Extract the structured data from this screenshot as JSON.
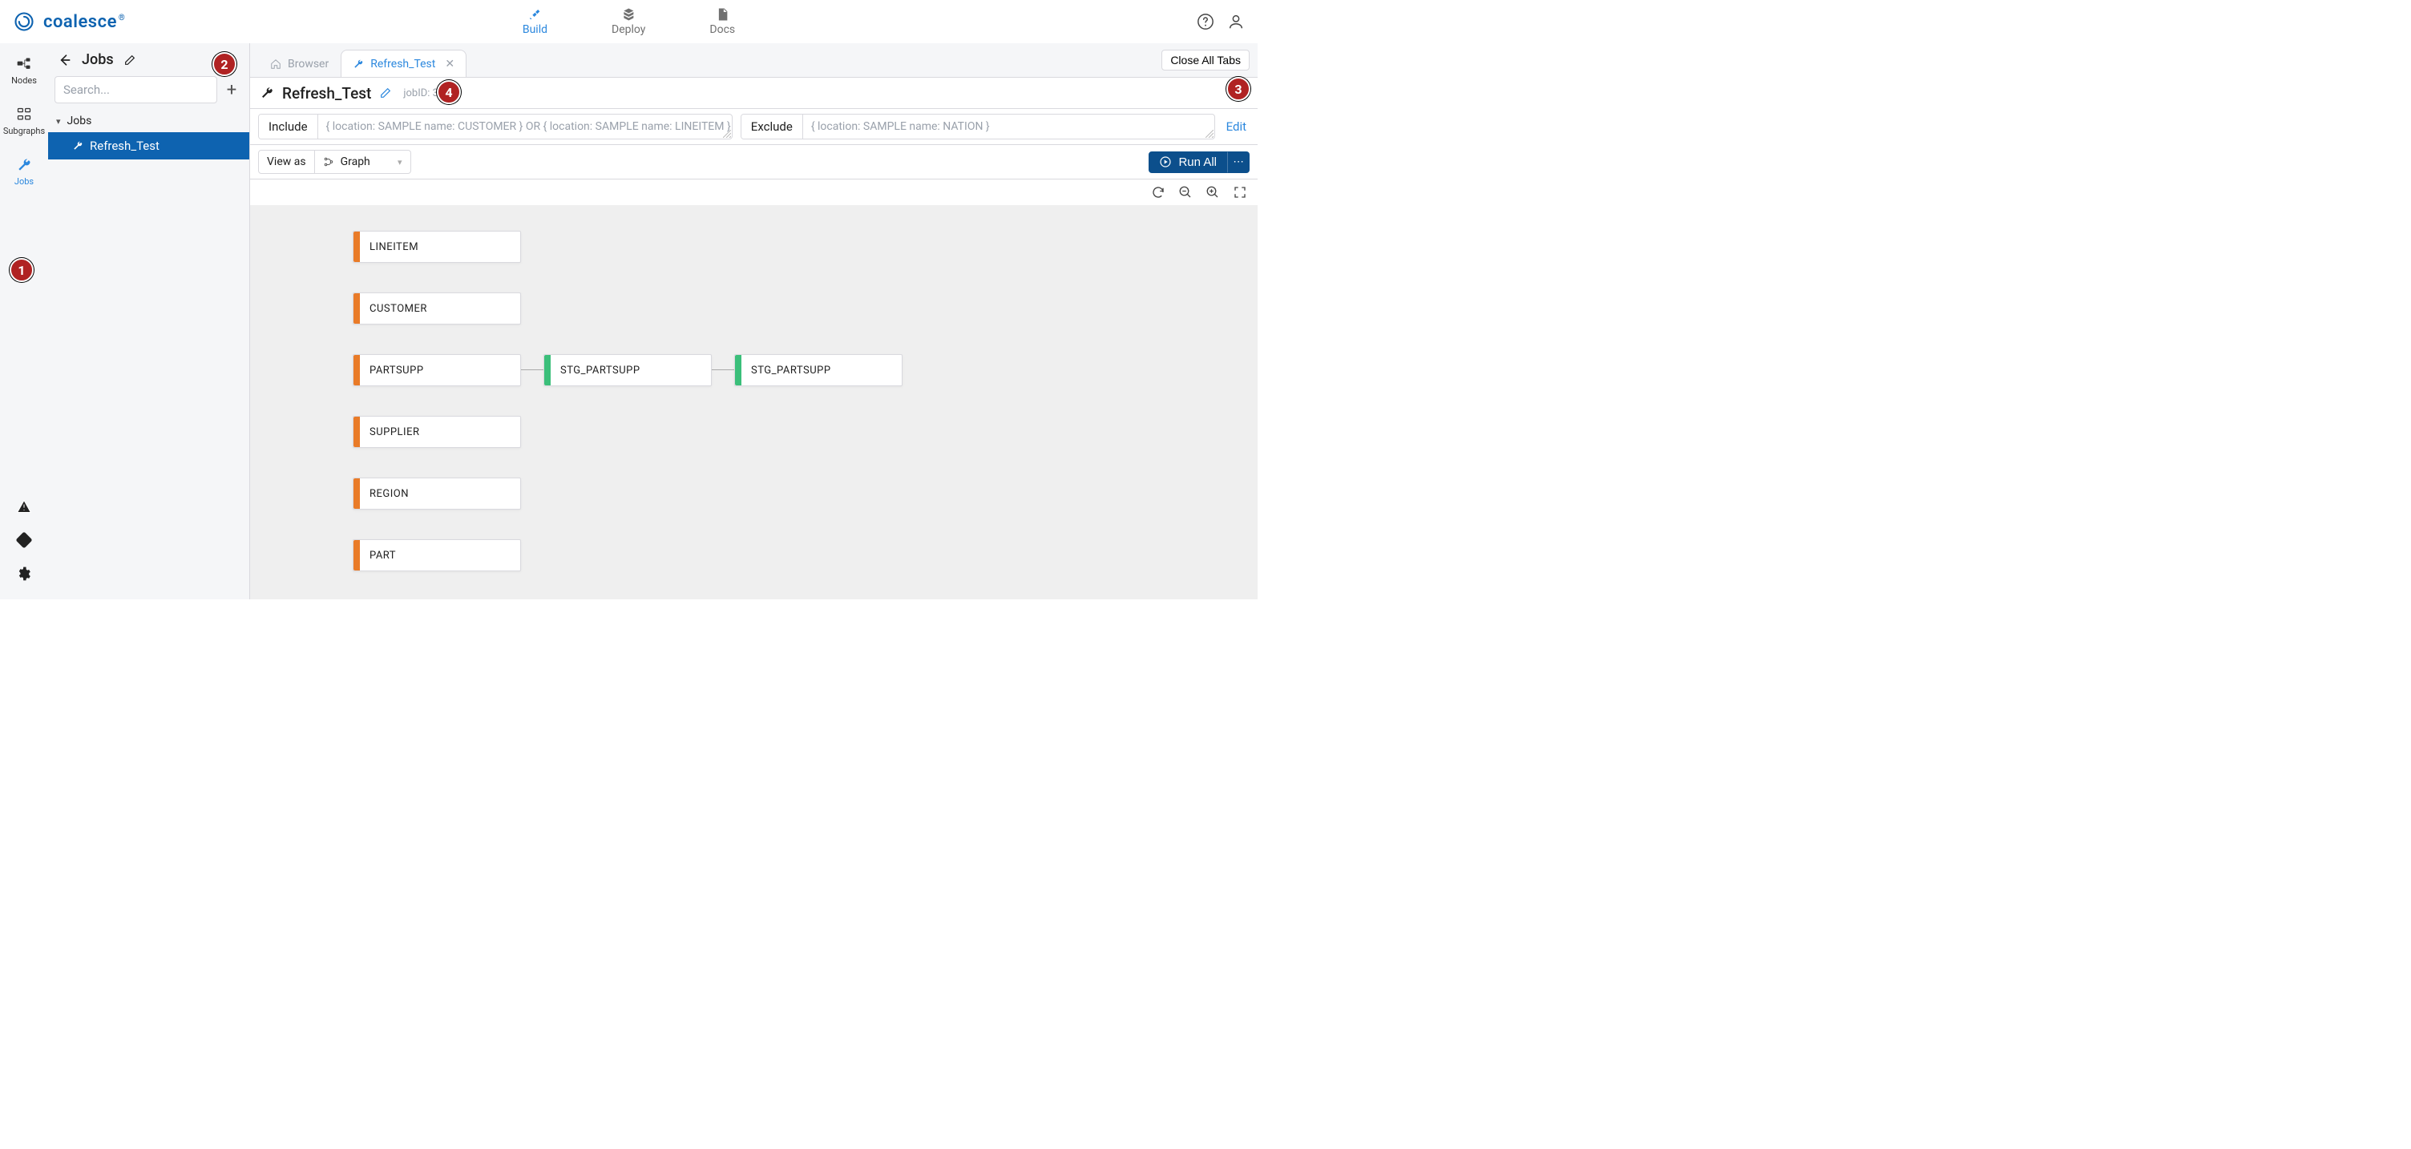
{
  "brand": {
    "name": "coalesce",
    "registered": "®"
  },
  "topnav": {
    "build": "Build",
    "deploy": "Deploy",
    "docs": "Docs"
  },
  "leftrail": {
    "nodes": "Nodes",
    "subgraphs": "Subgraphs",
    "jobs": "Jobs"
  },
  "navpanel": {
    "title": "Jobs",
    "search_placeholder": "Search...",
    "tree_group": "Jobs",
    "tree_item": "Refresh_Test"
  },
  "tabs": {
    "browser": "Browser",
    "active": "Refresh_Test",
    "close_all": "Close All Tabs"
  },
  "titlebar": {
    "name": "Refresh_Test",
    "jobid_label": "jobID: 3"
  },
  "filters": {
    "include_label": "Include",
    "include_value": "{ location: SAMPLE name: CUSTOMER } OR { location: SAMPLE name: LINEITEM }",
    "exclude_label": "Exclude",
    "exclude_value": "{ location: SAMPLE name: NATION }",
    "edit": "Edit"
  },
  "viewrow": {
    "label": "View as",
    "mode": "Graph",
    "run_all": "Run All"
  },
  "nodes": {
    "lineitem": "LINEITEM",
    "customer": "CUSTOMER",
    "partsupp": "PARTSUPP",
    "stg_partsupp_1": "STG_PARTSUPP",
    "stg_partsupp_2": "STG_PARTSUPP",
    "supplier": "SUPPLIER",
    "region": "REGION",
    "part": "PART"
  },
  "steps": {
    "s1": "1",
    "s2": "2",
    "s3": "3",
    "s4": "4"
  }
}
